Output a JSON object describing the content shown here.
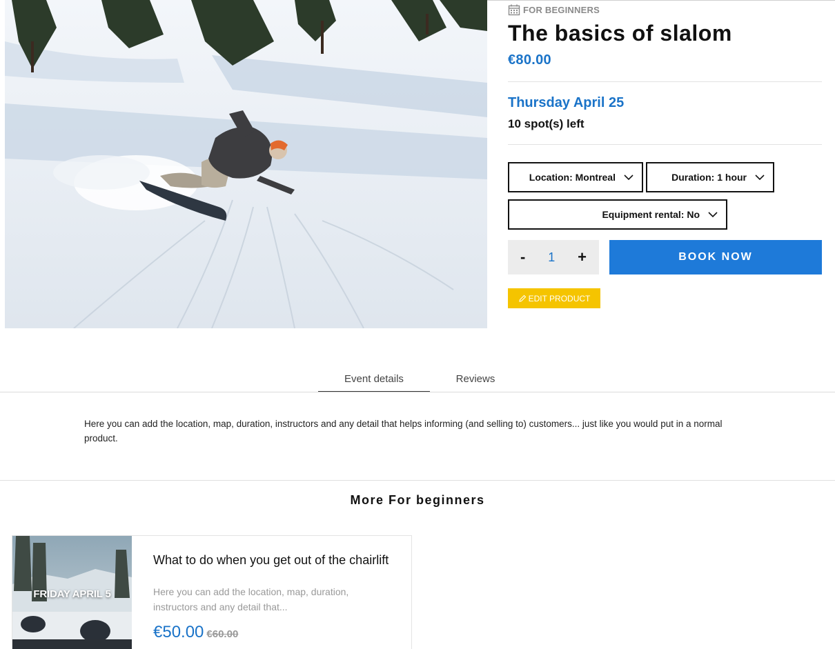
{
  "product": {
    "category": "FOR BEGINNERS",
    "title": "The basics of slalom",
    "price": "€80.00",
    "date": "Thursday April 25",
    "spots": "10 spot(s) left",
    "options": {
      "location": "Location: Montreal",
      "duration": "Duration: 1 hour",
      "equipment": "Equipment rental: No"
    },
    "quantity": {
      "minus": "-",
      "value": "1",
      "plus": "+"
    },
    "book_label": "BOOK NOW",
    "edit_label": "EDIT PRODUCT"
  },
  "tabs": [
    {
      "label": "Event details",
      "active": true
    },
    {
      "label": "Reviews",
      "active": false
    }
  ],
  "description": "Here you can add the location, map, duration, instructors and any detail that helps informing (and selling to) customers... just like you would put in a normal product.",
  "more": {
    "title": "More For beginners",
    "cards": [
      {
        "date": "FRIDAY APRIL 5",
        "title": "What to do when you get out of the chairlift",
        "excerpt": "Here you can add the location, map, duration, instructors and any detail that...",
        "price": "€50.00",
        "old_price": "€60.00"
      }
    ]
  },
  "colors": {
    "accent": "#1a73c8",
    "button": "#1e7ad9",
    "edit": "#f5c400",
    "muted": "#8a8a8a"
  }
}
